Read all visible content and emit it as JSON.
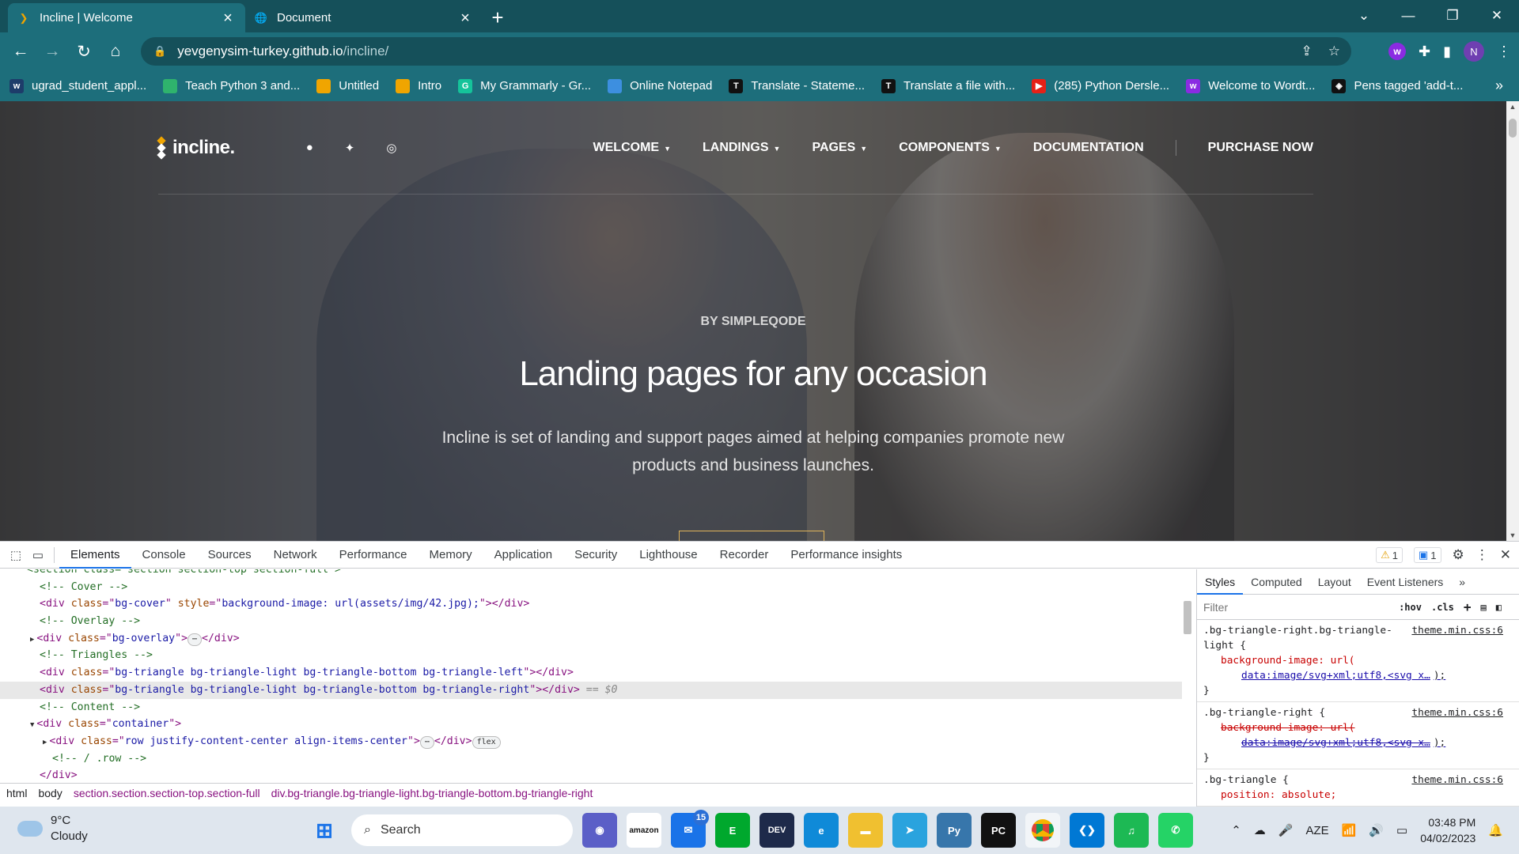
{
  "browser": {
    "tabs": [
      {
        "title": "Incline | Welcome",
        "active": true
      },
      {
        "title": "Document",
        "active": false
      }
    ],
    "address": {
      "host": "yevgenysim-turkey.github.io",
      "path": "/incline/"
    },
    "profile_initial": "N",
    "bookmarks": [
      {
        "label": "ugrad_student_appl...",
        "icon": "w",
        "color": "#1d3c6a"
      },
      {
        "label": "Teach Python 3 and...",
        "icon": "",
        "color": "#2fb36d"
      },
      {
        "label": "Untitled",
        "icon": "",
        "color": "#f0a500"
      },
      {
        "label": "Intro",
        "icon": "",
        "color": "#f0a500"
      },
      {
        "label": "My Grammarly - Gr...",
        "icon": "G",
        "color": "#15c39a"
      },
      {
        "label": "Online Notepad",
        "icon": "",
        "color": "#3d8fe0"
      },
      {
        "label": "Translate - Stateme...",
        "icon": "T",
        "color": "#111111"
      },
      {
        "label": "Translate a file with...",
        "icon": "T",
        "color": "#111111"
      },
      {
        "label": "(285) Python Dersle...",
        "icon": "▶",
        "color": "#e62117"
      },
      {
        "label": "Welcome to Wordt...",
        "icon": "w",
        "color": "#8a2be2"
      },
      {
        "label": "Pens tagged 'add-t...",
        "icon": "◈",
        "color": "#111111"
      }
    ]
  },
  "site": {
    "logo": "incline.",
    "nav": [
      {
        "label": "WELCOME",
        "dropdown": true
      },
      {
        "label": "LANDINGS",
        "dropdown": true
      },
      {
        "label": "PAGES",
        "dropdown": true
      },
      {
        "label": "COMPONENTS",
        "dropdown": true
      },
      {
        "label": "DOCUMENTATION",
        "dropdown": false
      }
    ],
    "purchase": "PURCHASE NOW",
    "eyebrow": "BY SIMPLEQODE",
    "headline": "Landing pages for any occasion",
    "lead": "Incline is set of landing and support pages aimed at helping companies promote new products and business launches."
  },
  "devtools": {
    "tabs": [
      "Elements",
      "Console",
      "Sources",
      "Network",
      "Performance",
      "Memory",
      "Application",
      "Security",
      "Lighthouse",
      "Recorder",
      "Performance insights"
    ],
    "warnings": "1",
    "messages": "1",
    "dom_lines": [
      {
        "indent": 0,
        "parts": [
          [
            "cm",
            "<section class=\"section section-top section-full\">"
          ]
        ]
      },
      {
        "indent": 1,
        "parts": [
          [
            "cm",
            "<!-- Cover -->"
          ]
        ]
      },
      {
        "indent": 1,
        "parts": [
          [
            "tag",
            "<div "
          ],
          [
            "attr",
            "class"
          ],
          [
            "tag",
            "=\""
          ],
          [
            "val",
            "bg-cover"
          ],
          [
            "tag",
            "\" "
          ],
          [
            "attr",
            "style"
          ],
          [
            "tag",
            "=\""
          ],
          [
            "val",
            "background-image: url(assets/img/42.jpg);"
          ],
          [
            "tag",
            "\"></div>"
          ]
        ]
      },
      {
        "indent": 1,
        "parts": [
          [
            "cm",
            "<!-- Overlay -->"
          ]
        ]
      },
      {
        "indent": 1,
        "toggle": "▶",
        "parts": [
          [
            "tag",
            "<div "
          ],
          [
            "attr",
            "class"
          ],
          [
            "tag",
            "=\""
          ],
          [
            "val",
            "bg-overlay"
          ],
          [
            "tag",
            "\">"
          ],
          [
            "pill",
            "⋯"
          ],
          [
            "tag",
            "</div>"
          ]
        ]
      },
      {
        "indent": 1,
        "parts": [
          [
            "cm",
            "<!-- Triangles -->"
          ]
        ]
      },
      {
        "indent": 1,
        "parts": [
          [
            "tag",
            "<div "
          ],
          [
            "attr",
            "class"
          ],
          [
            "tag",
            "=\""
          ],
          [
            "val",
            "bg-triangle bg-triangle-light bg-triangle-bottom bg-triangle-left"
          ],
          [
            "tag",
            "\"></div>"
          ]
        ]
      },
      {
        "indent": 1,
        "selected": true,
        "parts": [
          [
            "tag",
            "<div "
          ],
          [
            "attr",
            "class"
          ],
          [
            "tag",
            "=\""
          ],
          [
            "val",
            "bg-triangle bg-triangle-light bg-triangle-bottom bg-triangle-right"
          ],
          [
            "tag",
            "\"></div>"
          ],
          [
            "dim",
            " == $0"
          ]
        ]
      },
      {
        "indent": 1,
        "parts": [
          [
            "cm",
            "<!-- Content -->"
          ]
        ]
      },
      {
        "indent": 1,
        "toggle": "▼",
        "parts": [
          [
            "tag",
            "<div "
          ],
          [
            "attr",
            "class"
          ],
          [
            "tag",
            "=\""
          ],
          [
            "val",
            "container"
          ],
          [
            "tag",
            "\">"
          ]
        ]
      },
      {
        "indent": 2,
        "toggle": "▶",
        "parts": [
          [
            "tag",
            "<div "
          ],
          [
            "attr",
            "class"
          ],
          [
            "tag",
            "=\""
          ],
          [
            "val",
            "row justify-content-center align-items-center"
          ],
          [
            "tag",
            "\">"
          ],
          [
            "pill",
            "⋯"
          ],
          [
            "tag",
            "</div>"
          ],
          [
            "pill",
            "flex"
          ]
        ]
      },
      {
        "indent": 2,
        "parts": [
          [
            "cm",
            "<!-- / .row -->"
          ]
        ]
      },
      {
        "indent": 1,
        "parts": [
          [
            "tag",
            "</div>"
          ]
        ]
      }
    ],
    "breadcrumb": [
      "html",
      "body",
      "section.section.section-top.section-full",
      "div.bg-triangle.bg-triangle-light.bg-triangle-bottom.bg-triangle-right"
    ],
    "styles_tabs": [
      "Styles",
      "Computed",
      "Layout",
      "Event Listeners"
    ],
    "filter_placeholder": "Filter",
    "hov": ":hov",
    "cls": ".cls",
    "rules": [
      {
        "selector": ".bg-triangle-right.bg-triangle-light {",
        "source": "theme.min.css:6",
        "prop": "background-image: url(",
        "link": "data:image/svg+xml;utf8,<svg x…",
        "tail": ");",
        "struck": false
      },
      {
        "selector": ".bg-triangle-right {",
        "source": "theme.min.css:6",
        "prop": "background-image: url(",
        "link": "data:image/svg+xml;utf8,<svg x…",
        "tail": ");",
        "struck": true
      },
      {
        "selector": ".bg-triangle {",
        "source": "theme.min.css:6",
        "prop": "position: absolute;",
        "link": "",
        "tail": "",
        "struck": false
      }
    ]
  },
  "taskbar": {
    "temp": "9°C",
    "condition": "Cloudy",
    "search": "Search",
    "mail_count": "15",
    "lang": "AZE",
    "time": "03:48 PM",
    "date": "04/02/2023"
  }
}
